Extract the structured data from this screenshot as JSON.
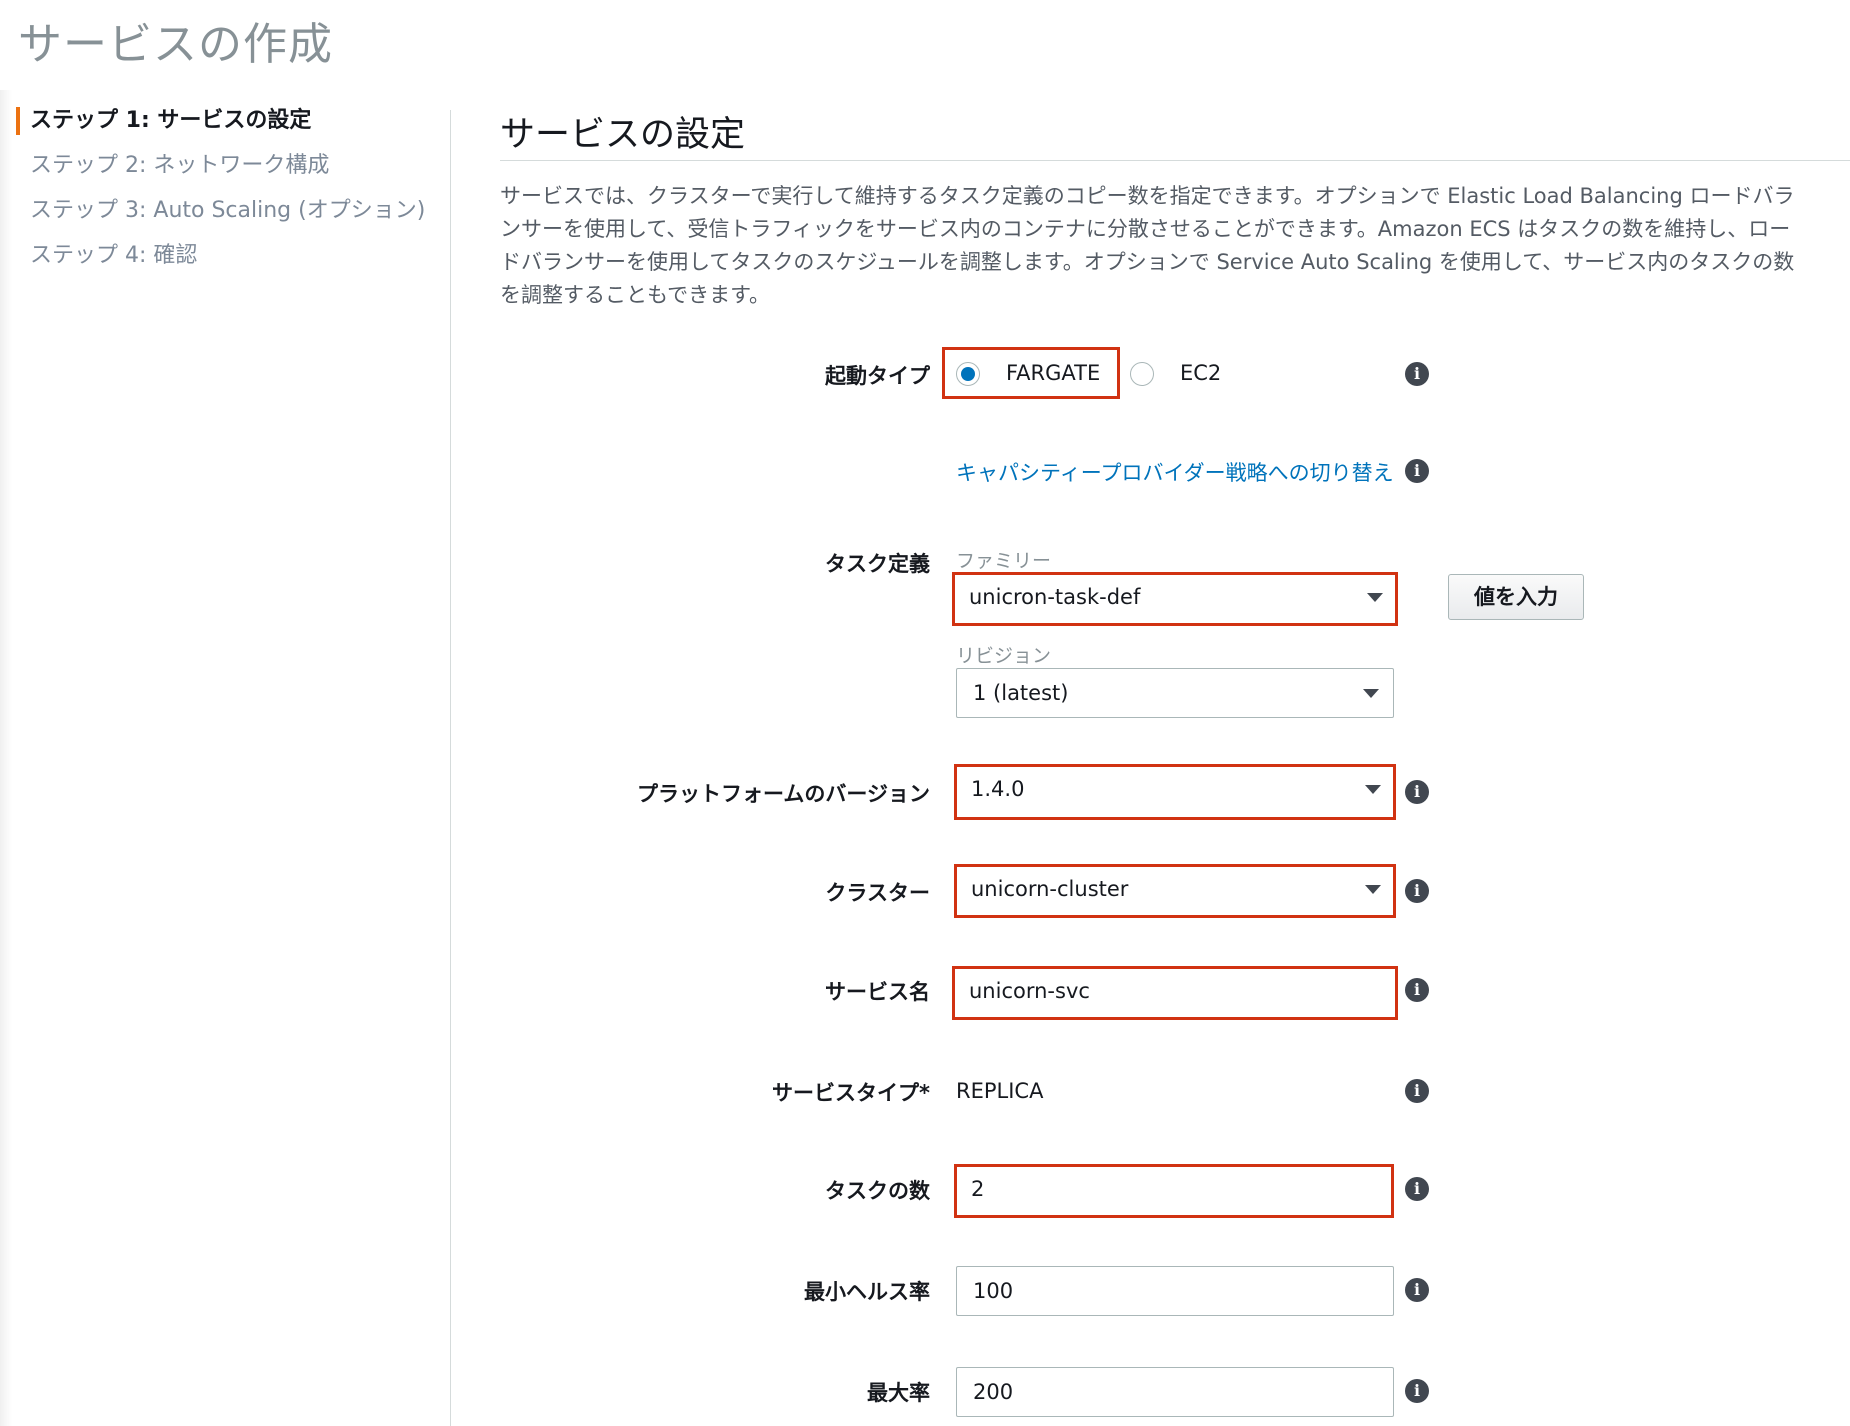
{
  "page": {
    "title": "サービスの作成"
  },
  "sidebar": {
    "steps": [
      {
        "label": "ステップ 1: サービスの設定"
      },
      {
        "label": "ステップ 2: ネットワーク構成"
      },
      {
        "label": "ステップ 3: Auto Scaling (オプション)"
      },
      {
        "label": "ステップ 4: 確認"
      }
    ],
    "active_step": 1
  },
  "section": {
    "title": "サービスの設定",
    "description": "サービスでは、クラスターで実行して維持するタスク定義のコピー数を指定できます。オプションで Elastic Load Balancing ロードバランサーを使用して、受信トラフィックをサービス内のコンテナに分散させることができます。Amazon ECS はタスクの数を維持し、ロードバランサーを使用してタスクのスケジュールを調整します。オプションで Service Auto Scaling を使用して、サービス内のタスクの数を調整することもできます。"
  },
  "form": {
    "launch_type": {
      "label": "起動タイプ",
      "options": [
        "FARGATE",
        "EC2"
      ],
      "selected": "FARGATE"
    },
    "capacity_provider_link": "キャパシティープロバイダー戦略への切り替え",
    "task_definition": {
      "label": "タスク定義",
      "family_label": "ファミリー",
      "family_value": "unicron-task-def",
      "revision_label": "リビジョン",
      "revision_value": "1 (latest)",
      "enter_value_button": "値を入力"
    },
    "platform_version": {
      "label": "プラットフォームのバージョン",
      "value": "1.4.0"
    },
    "cluster": {
      "label": "クラスター",
      "value": "unicorn-cluster"
    },
    "service_name": {
      "label": "サービス名",
      "value": "unicorn-svc"
    },
    "service_type": {
      "label": "サービスタイプ*",
      "value": "REPLICA"
    },
    "task_count": {
      "label": "タスクの数",
      "value": "2"
    },
    "min_healthy_percent": {
      "label": "最小ヘルス率",
      "value": "100"
    },
    "max_percent": {
      "label": "最大率",
      "value": "200"
    }
  },
  "icons": {
    "info": "info-icon"
  },
  "colors": {
    "highlight": "#d13212",
    "link": "#0073bb",
    "active_step_marker": "#ec7211"
  }
}
